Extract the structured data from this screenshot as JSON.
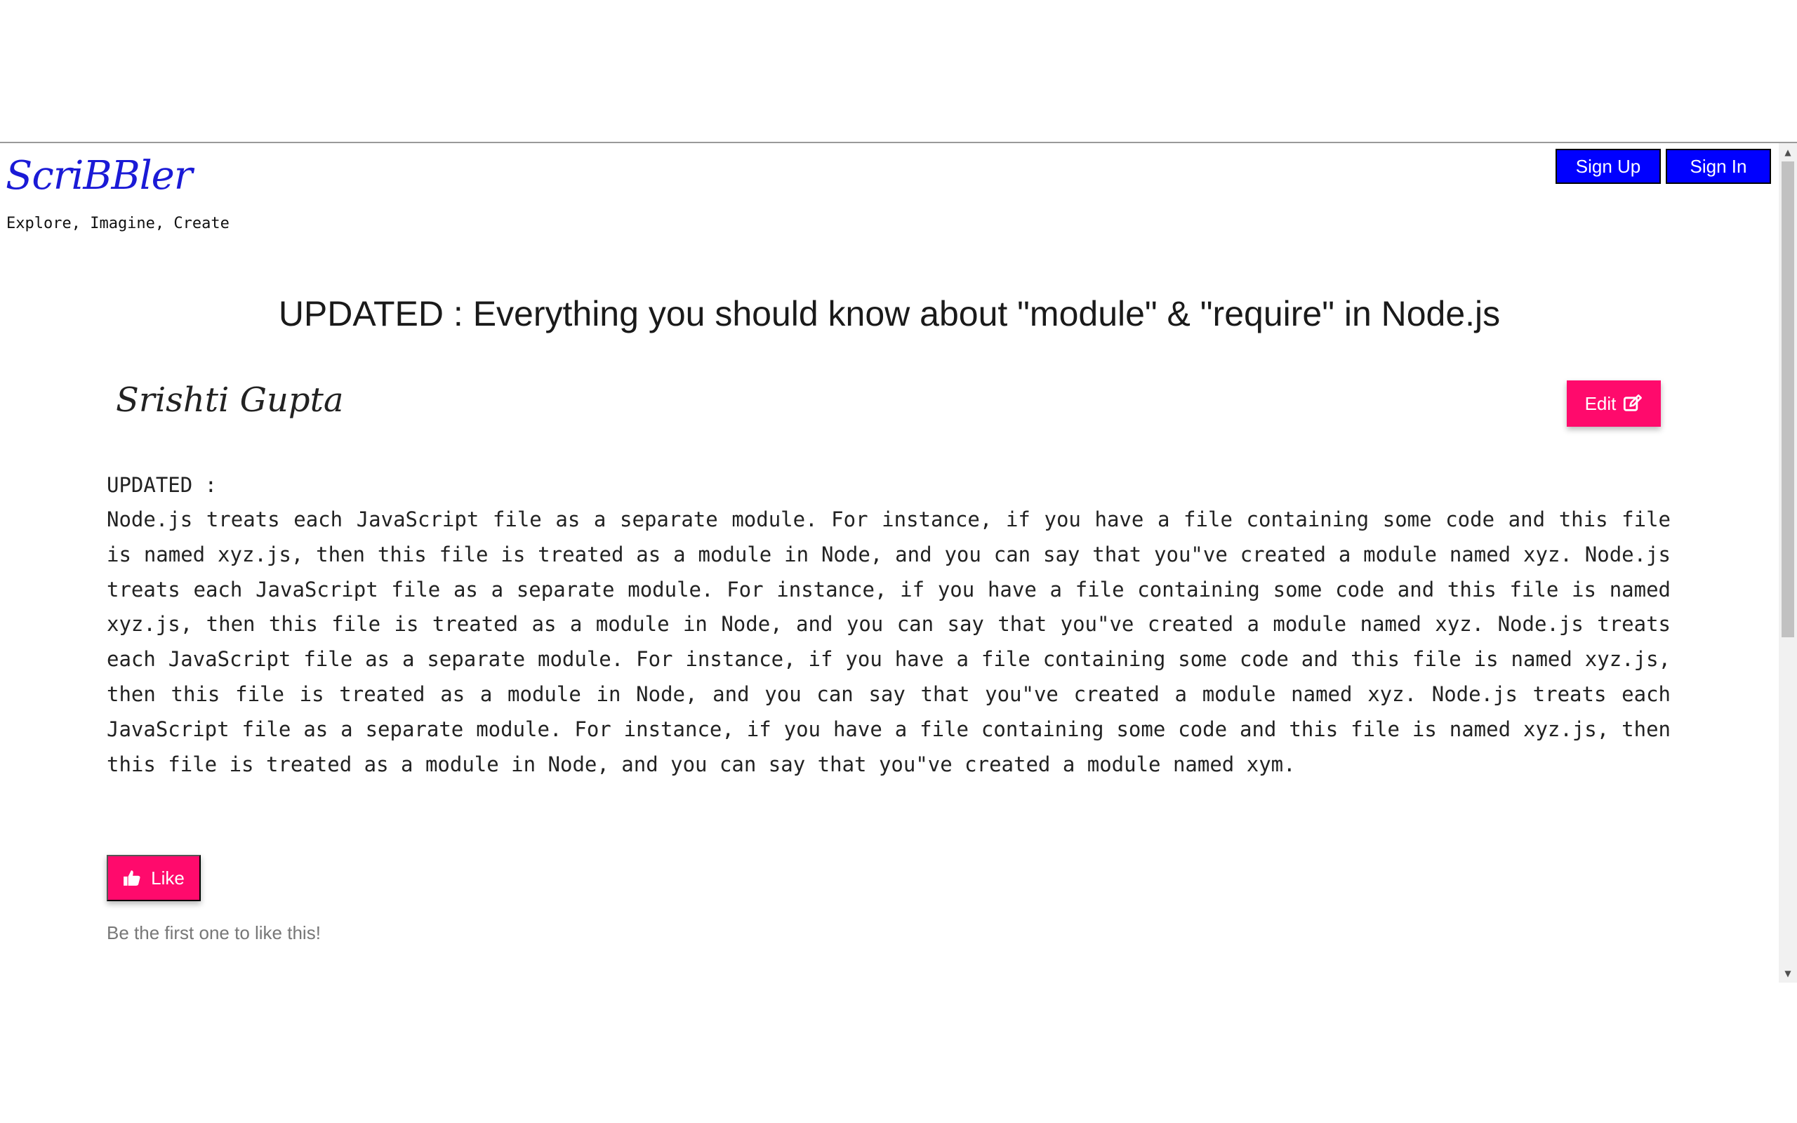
{
  "header": {
    "brand": "ScriBBler",
    "tagline": "Explore, Imagine, Create",
    "signup_label": "Sign Up",
    "signin_label": "Sign In"
  },
  "article": {
    "title": "UPDATED : Everything you should know about \"module\" & \"require\" in Node.js",
    "author": "Srishti Gupta",
    "edit_label": "Edit",
    "heading": "UPDATED :",
    "body": "Node.js treats each JavaScript file as a separate module. For instance, if you have a file containing some code and this file is named xyz.js, then this file is treated as a module in Node, and you can say that you\"ve created a module named xyz. Node.js treats each JavaScript file as a separate module. For instance, if you have a file containing some code and this file is named xyz.js, then this file is treated as a module in Node, and you can say that you\"ve created a module named xyz. Node.js treats each JavaScript file as a separate module. For instance, if you have a file containing some code and this file is named xyz.js, then this file is treated as a module in Node, and you can say that you\"ve created a module named xyz. Node.js treats each JavaScript file as a separate module. For instance, if you have a file containing some code and this file is named xyz.js, then this file is treated as a module in Node, and you can say that you\"ve created a module named xym."
  },
  "like": {
    "label": "Like",
    "status": "Be the first one to like this!"
  },
  "icons": {
    "edit": "edit-icon",
    "like": "thumbs-up-icon",
    "scroll_up": "scroll-up-arrow-icon",
    "scroll_down": "scroll-down-arrow-icon"
  },
  "colors": {
    "brand": "#1a1ad6",
    "auth_button_bg": "#0000ff",
    "accent": "#ff0a6c",
    "muted_text": "#777777"
  }
}
